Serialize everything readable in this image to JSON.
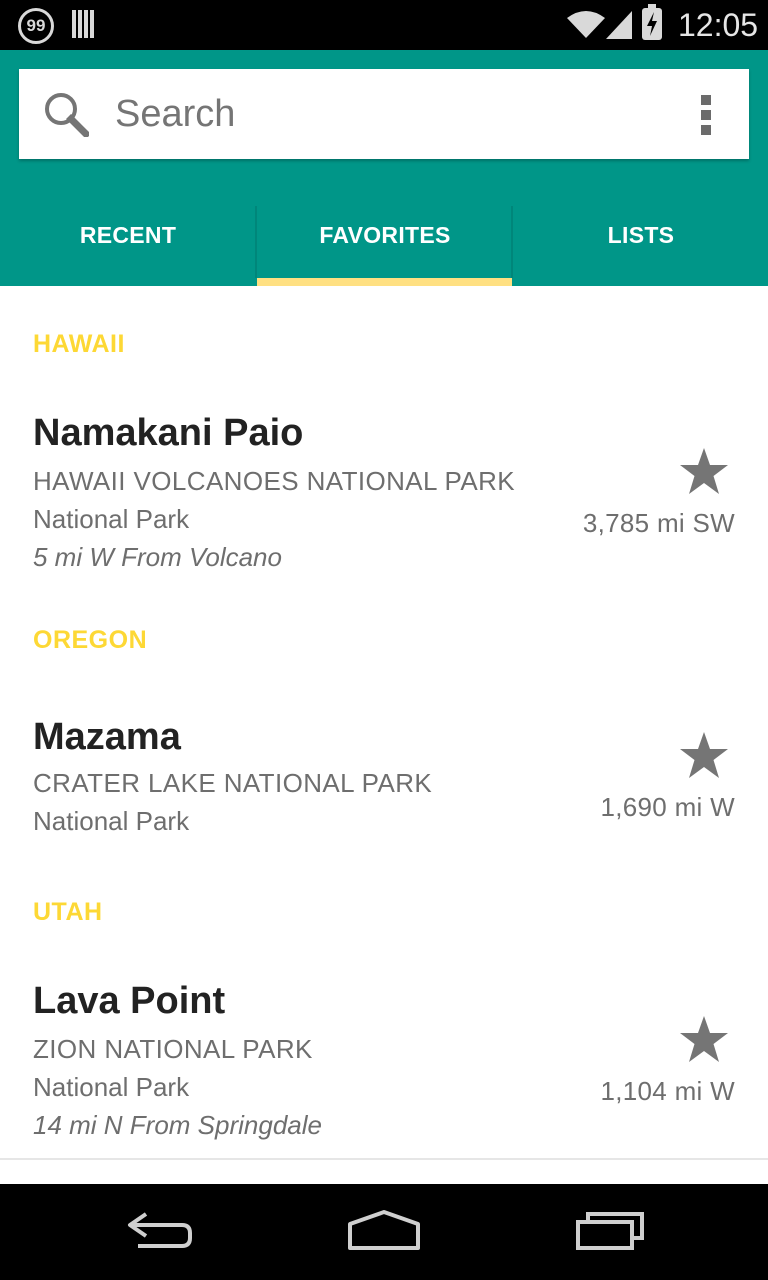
{
  "status_bar": {
    "notification_badge": "99",
    "time": "12:05",
    "icons": [
      "notification-count-icon",
      "barcode-icon",
      "wifi-icon",
      "cell-signal-icon",
      "battery-charging-icon"
    ]
  },
  "search": {
    "placeholder": "Search",
    "value": ""
  },
  "tabs": [
    {
      "label": "RECENT",
      "selected": false
    },
    {
      "label": "FAVORITES",
      "selected": true
    },
    {
      "label": "LISTS",
      "selected": false
    }
  ],
  "colors": {
    "app_bar": "#009688",
    "tab_indicator": "#ffe082",
    "section_header": "#fdd835",
    "star": "#757575"
  },
  "sections": [
    {
      "header": "HAWAII",
      "items": [
        {
          "name": "Namakani Paio",
          "park": "HAWAII VOLCANOES NATIONAL PARK",
          "type": "National Park",
          "from": "5 mi W From Volcano",
          "distance": "3,785 mi SW",
          "favorite": true
        }
      ]
    },
    {
      "header": "OREGON",
      "items": [
        {
          "name": "Mazama",
          "park": "CRATER LAKE NATIONAL PARK",
          "type": "National Park",
          "distance": "1,690 mi W",
          "favorite": true
        }
      ]
    },
    {
      "header": "UTAH",
      "items": [
        {
          "name": "Lava Point",
          "park": "ZION NATIONAL PARK",
          "type": "National Park",
          "from": "14 mi N From Springdale",
          "distance": "1,104 mi W",
          "favorite": true
        }
      ]
    }
  ],
  "nav_bar": {
    "icons": [
      "back-icon",
      "home-icon",
      "recent-apps-icon"
    ]
  }
}
